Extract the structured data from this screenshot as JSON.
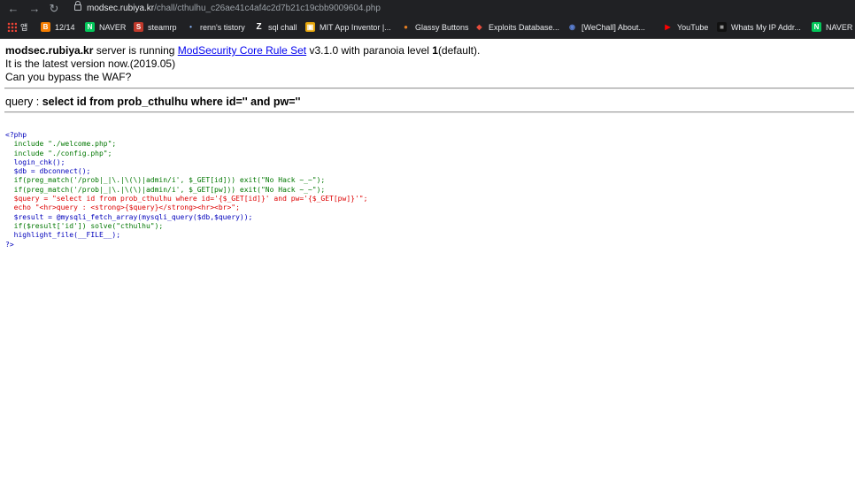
{
  "browser": {
    "url_host": "modsec.rubiya.kr",
    "url_path": "/chall/cthulhu_c26ae41c4af4c2d7b21c19cbb9009604.php",
    "bookmarks": [
      {
        "label": "12/14",
        "icon": "blogger-icon",
        "color": "#f57d00",
        "glyph": "B"
      },
      {
        "label": "NAVER",
        "icon": "naver-icon",
        "color": "#03c75a",
        "glyph": "N"
      },
      {
        "label": "steamrp",
        "icon": "steam-icon",
        "color": "#c0392b",
        "glyph": "S"
      },
      {
        "label": "renn's tistory",
        "icon": "tistory-icon",
        "color": "#3b82f6",
        "glyph": "•"
      },
      {
        "label": "sql chall",
        "icon": "z-icon",
        "color": "#202124",
        "glyph": "Z"
      },
      {
        "label": "MIT App Inventor |...",
        "icon": "app-inventor-icon",
        "color": "#e5a50a",
        "glyph": "▣"
      },
      {
        "label": "Glassy Buttons",
        "icon": "glassy-icon",
        "color": "#e67e22",
        "glyph": "●"
      },
      {
        "label": "Exploits Database...",
        "icon": "exploit-db-icon",
        "color": "#e74c3c",
        "glyph": "◆"
      },
      {
        "label": "[WeChall] About...",
        "icon": "wechall-icon",
        "color": "#5b7fd1",
        "glyph": "◉"
      },
      {
        "label": "YouTube",
        "icon": "youtube-icon",
        "color": "#ff0000",
        "glyph": "▶"
      },
      {
        "label": "Whats My IP Addr...",
        "icon": "ip-icon",
        "color": "#333333",
        "glyph": "■"
      },
      {
        "label": "NAVER",
        "icon": "naver-icon",
        "color": "#03c75a",
        "glyph": "N"
      }
    ],
    "apps_label": "앱"
  },
  "page": {
    "server_host": "modsec.rubiya.kr",
    "server_text1": " server is running ",
    "crs_link": "ModSecurity Core Rule Set",
    "server_text2": " v3.1.0 with paranoia level ",
    "paranoia_level": "1",
    "server_text3": "(default).",
    "latest_line": "It is the latest version now.(2019.05)",
    "bypass_line": "Can you bypass the WAF?",
    "query_label": "query : ",
    "query_value": "select id from prob_cthulhu where id='' and pw=''"
  },
  "source_code": [
    "<?php",
    "  include \"./welcome.php\";",
    "  include \"./config.php\";",
    "  login_chk();",
    "  $db = dbconnect();",
    "  if(preg_match('/prob|_|\\.|\\(\\)|admin/i', $_GET[id])) exit(\"No Hack ~_~\");",
    "  if(preg_match('/prob|_|\\.|\\(\\)|admin/i', $_GET[pw])) exit(\"No Hack ~_~\");",
    "  $query = \"select id from prob_cthulhu where id='{$_GET[id]}' and pw='{$_GET[pw]}'\";",
    "  echo \"<hr>query : <strong>{$query}</strong><hr><br>\";",
    "  $result = @mysqli_fetch_array(mysqli_query($db,$query));",
    "  if($result['id']) solve(\"cthulhu\");",
    "  highlight_file(__FILE__);",
    "?>"
  ]
}
